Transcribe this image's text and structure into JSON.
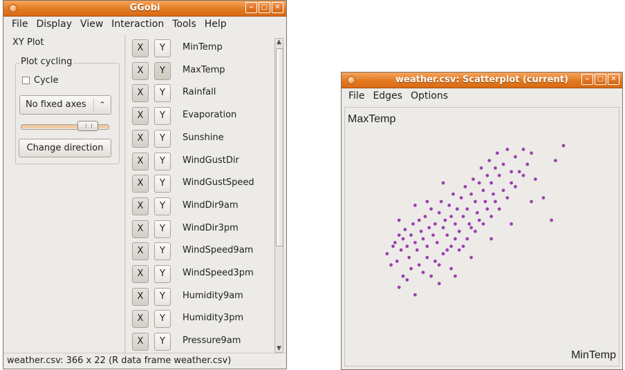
{
  "main_window": {
    "title": "GGobi",
    "menu": [
      "File",
      "Display",
      "View",
      "Interaction",
      "Tools",
      "Help"
    ],
    "mode_label": "XY Plot",
    "plot_cycling": {
      "legend": "Plot cycling",
      "cycle_label": "Cycle",
      "cycle_checked": false,
      "axes_option": "No fixed axes",
      "speed_fraction": 0.78,
      "change_direction_label": "Change direction"
    },
    "variables": [
      {
        "name": "MinTemp",
        "x": true,
        "y": false
      },
      {
        "name": "MaxTemp",
        "x": false,
        "y": true
      },
      {
        "name": "Rainfall",
        "x": false,
        "y": false
      },
      {
        "name": "Evaporation",
        "x": false,
        "y": false
      },
      {
        "name": "Sunshine",
        "x": false,
        "y": false
      },
      {
        "name": "WindGustDir",
        "x": false,
        "y": false
      },
      {
        "name": "WindGustSpeed",
        "x": false,
        "y": false
      },
      {
        "name": "WindDir9am",
        "x": false,
        "y": false
      },
      {
        "name": "WindDir3pm",
        "x": false,
        "y": false
      },
      {
        "name": "WindSpeed9am",
        "x": false,
        "y": false
      },
      {
        "name": "WindSpeed3pm",
        "x": false,
        "y": false
      },
      {
        "name": "Humidity9am",
        "x": false,
        "y": false
      },
      {
        "name": "Humidity3pm",
        "x": false,
        "y": false
      },
      {
        "name": "Pressure9am",
        "x": false,
        "y": false
      }
    ],
    "x_button_label": "X",
    "y_button_label": "Y",
    "status": "weather.csv: 366 x 22 (R data frame weather.csv)"
  },
  "scatter_window": {
    "title": "weather.csv: Scatterplot (current)",
    "menu": [
      "File",
      "Edges",
      "Options"
    ],
    "y_axis_label": "MaxTemp",
    "x_axis_label": "MinTemp",
    "point_color": "#9b3fb0"
  },
  "chart_data": {
    "type": "scatter",
    "xlabel": "MinTemp",
    "ylabel": "MaxTemp",
    "series": [
      {
        "color": "#9b3fb0",
        "points": [
          [
            0.02,
            0.42
          ],
          [
            0.05,
            0.46
          ],
          [
            0.06,
            0.48
          ],
          [
            0.08,
            0.52
          ],
          [
            0.07,
            0.38
          ],
          [
            0.09,
            0.44
          ],
          [
            0.1,
            0.5
          ],
          [
            0.11,
            0.55
          ],
          [
            0.12,
            0.46
          ],
          [
            0.13,
            0.4
          ],
          [
            0.14,
            0.52
          ],
          [
            0.15,
            0.58
          ],
          [
            0.16,
            0.48
          ],
          [
            0.17,
            0.44
          ],
          [
            0.18,
            0.6
          ],
          [
            0.19,
            0.54
          ],
          [
            0.2,
            0.5
          ],
          [
            0.21,
            0.62
          ],
          [
            0.22,
            0.46
          ],
          [
            0.23,
            0.56
          ],
          [
            0.24,
            0.66
          ],
          [
            0.25,
            0.52
          ],
          [
            0.26,
            0.58
          ],
          [
            0.27,
            0.48
          ],
          [
            0.28,
            0.64
          ],
          [
            0.29,
            0.7
          ],
          [
            0.3,
            0.56
          ],
          [
            0.31,
            0.6
          ],
          [
            0.32,
            0.52
          ],
          [
            0.33,
            0.68
          ],
          [
            0.34,
            0.62
          ],
          [
            0.35,
            0.74
          ],
          [
            0.36,
            0.58
          ],
          [
            0.37,
            0.66
          ],
          [
            0.38,
            0.54
          ],
          [
            0.39,
            0.72
          ],
          [
            0.4,
            0.62
          ],
          [
            0.41,
            0.78
          ],
          [
            0.42,
            0.66
          ],
          [
            0.43,
            0.58
          ],
          [
            0.44,
            0.74
          ],
          [
            0.45,
            0.82
          ],
          [
            0.46,
            0.7
          ],
          [
            0.47,
            0.64
          ],
          [
            0.48,
            0.8
          ],
          [
            0.49,
            0.88
          ],
          [
            0.5,
            0.76
          ],
          [
            0.51,
            0.7
          ],
          [
            0.52,
            0.84
          ],
          [
            0.53,
            0.92
          ],
          [
            0.54,
            0.8
          ],
          [
            0.55,
            0.74
          ],
          [
            0.56,
            0.88
          ],
          [
            0.57,
            0.96
          ],
          [
            0.58,
            0.84
          ],
          [
            0.6,
            0.9
          ],
          [
            0.62,
            0.98
          ],
          [
            0.64,
            0.86
          ],
          [
            0.66,
            0.94
          ],
          [
            0.7,
            0.98
          ],
          [
            0.72,
            0.9
          ],
          [
            0.74,
            0.96
          ],
          [
            0.1,
            0.3
          ],
          [
            0.14,
            0.34
          ],
          [
            0.2,
            0.32
          ],
          [
            0.26,
            0.38
          ],
          [
            0.3,
            0.42
          ],
          [
            0.34,
            0.46
          ],
          [
            0.38,
            0.44
          ],
          [
            0.42,
            0.5
          ],
          [
            0.46,
            0.54
          ],
          [
            0.5,
            0.58
          ],
          [
            0.54,
            0.62
          ],
          [
            0.58,
            0.66
          ],
          [
            0.62,
            0.72
          ],
          [
            0.66,
            0.78
          ],
          [
            0.7,
            0.84
          ],
          [
            0.04,
            0.36
          ],
          [
            0.12,
            0.28
          ],
          [
            0.18,
            0.36
          ],
          [
            0.22,
            0.4
          ],
          [
            0.28,
            0.36
          ],
          [
            0.32,
            0.44
          ],
          [
            0.36,
            0.5
          ],
          [
            0.4,
            0.46
          ],
          [
            0.44,
            0.56
          ],
          [
            0.48,
            0.6
          ],
          [
            0.52,
            0.66
          ],
          [
            0.56,
            0.7
          ],
          [
            0.6,
            0.76
          ],
          [
            0.64,
            0.8
          ],
          [
            0.68,
            0.86
          ],
          [
            0.76,
            0.82
          ],
          [
            0.8,
            0.72
          ],
          [
            0.84,
            0.6
          ],
          [
            0.86,
            0.92
          ],
          [
            0.9,
            1.0
          ],
          [
            0.16,
            0.68
          ],
          [
            0.22,
            0.7
          ],
          [
            0.08,
            0.6
          ],
          [
            0.3,
            0.8
          ],
          [
            0.24,
            0.3
          ],
          [
            0.34,
            0.34
          ],
          [
            0.44,
            0.4
          ],
          [
            0.54,
            0.5
          ],
          [
            0.64,
            0.58
          ],
          [
            0.74,
            0.7
          ],
          [
            0.08,
            0.24
          ],
          [
            0.16,
            0.2
          ],
          [
            0.28,
            0.26
          ],
          [
            0.36,
            0.3
          ]
        ]
      }
    ]
  }
}
